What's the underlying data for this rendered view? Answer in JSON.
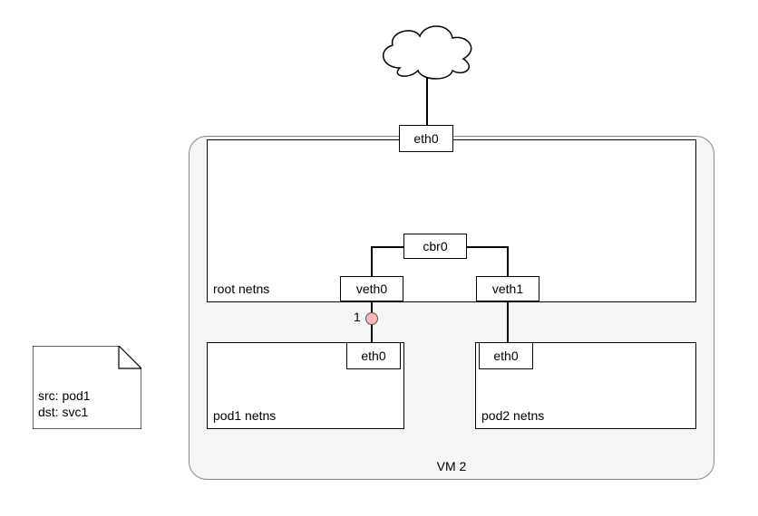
{
  "note": {
    "line1": "src: pod1",
    "line2": "dst: svc1"
  },
  "vm": {
    "label": "VM 2",
    "root_netns_label": "root netns",
    "eth0_top": "eth0",
    "cbr0": "cbr0",
    "veth0": "veth0",
    "veth1": "veth1",
    "pod1": {
      "label": "pod1 netns",
      "eth0": "eth0"
    },
    "pod2": {
      "label": "pod2 netns",
      "eth0": "eth0"
    },
    "marker1": "1"
  },
  "shapes": {
    "cloud": "cloud-icon"
  }
}
